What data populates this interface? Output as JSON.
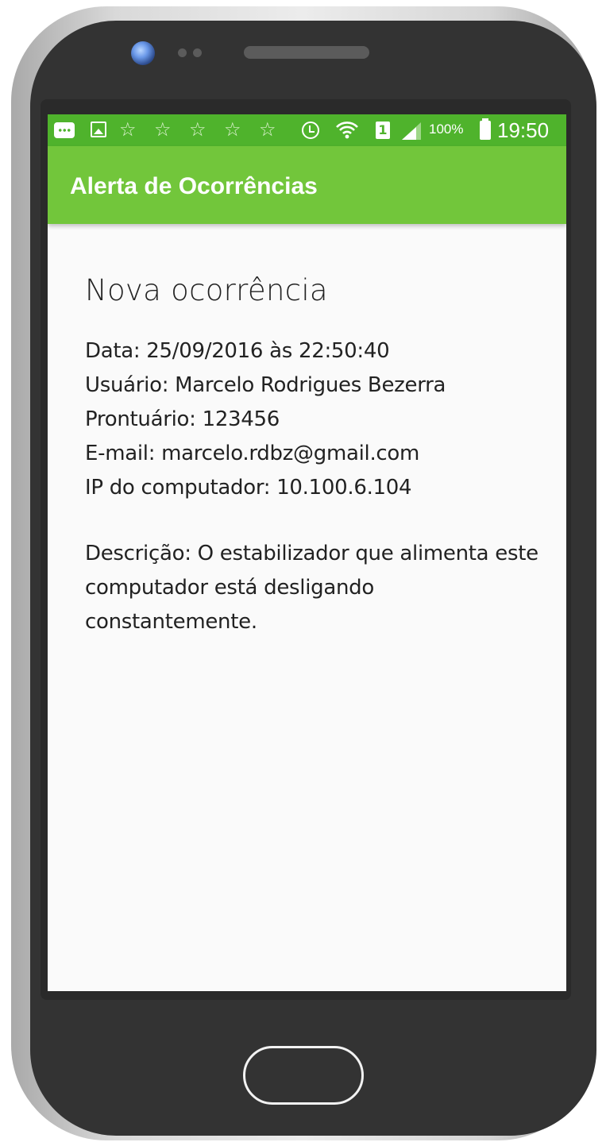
{
  "status_bar": {
    "battery_percent": "100%",
    "time": "19:50",
    "sim_slot": "1",
    "icons": [
      "message-icon",
      "image-icon",
      "star-icon",
      "star-icon",
      "star-icon",
      "star-icon",
      "star-icon",
      "alarm-icon",
      "wifi-icon",
      "sim-icon",
      "signal-icon",
      "battery-icon"
    ]
  },
  "app_bar": {
    "title": "Alerta de Ocorrências"
  },
  "alert": {
    "heading": "Nova ocorrência",
    "date_line": "Data: 25/09/2016 às 22:50:40",
    "user_line": "Usuário: Marcelo Rodrigues Bezerra",
    "record_line": "Prontuário: 123456",
    "email_line": "E-mail: marcelo.rdbz@gmail.com",
    "ip_line": "IP do computador: 10.100.6.104",
    "description": "Descrição: O estabilizador que alimenta este computador está desligando constantemente."
  },
  "colors": {
    "status_bar": "#4fb32c",
    "app_bar": "#72c63b",
    "phone_body": "#333333",
    "screen_background": "#fafafa"
  }
}
